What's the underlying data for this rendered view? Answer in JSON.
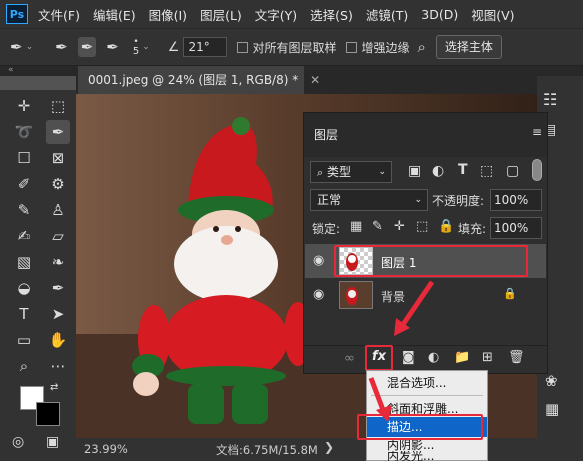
{
  "menubar": {
    "logo": "Ps",
    "items": [
      "文件(F)",
      "编辑(E)",
      "图像(I)",
      "图层(L)",
      "文字(Y)",
      "选择(S)",
      "滤镜(T)",
      "3D(D)",
      "视图(V)"
    ]
  },
  "options": {
    "brush_size": "5",
    "angle": "21°",
    "sample_all_layers": "对所有图层取样",
    "enhance_edge": "增强边缘",
    "select_subject": "选择主体"
  },
  "document": {
    "tab_title": "0001.jpeg @ 24% (图层 1, RGB/8) *",
    "zoom": "23.99%",
    "doc_size": "文档:6.75M/15.8M"
  },
  "layers_panel": {
    "title": "图层",
    "filter_kind": "类型",
    "blend_mode": "正常",
    "opacity_label": "不透明度:",
    "opacity_value": "100%",
    "lock_label": "锁定:",
    "fill_label": "填充:",
    "fill_value": "100%",
    "layers": [
      {
        "name": "图层 1",
        "selected": true
      },
      {
        "name": "背景",
        "selected": false,
        "locked": true
      }
    ]
  },
  "fx_menu": {
    "items": [
      "混合选项...",
      "斜面和浮雕...",
      "描边...",
      "内阴影...",
      "内发光..."
    ],
    "highlighted_index": 2
  },
  "colors": {
    "accent": "#0f65c8",
    "highlight_box": "#e8293a",
    "panel_bg": "#2f2f2f",
    "app_bg": "#323232"
  }
}
